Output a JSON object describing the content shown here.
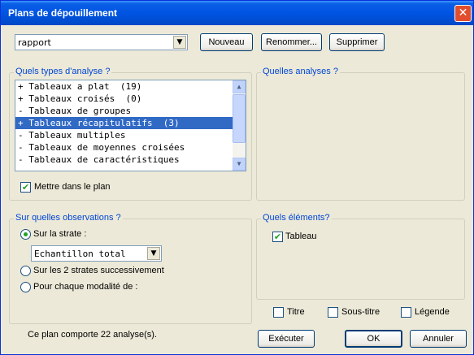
{
  "window": {
    "title": "Plans de dépouillement",
    "close_glyph": "✕"
  },
  "top": {
    "plan_combo_value": "rapport",
    "buttons": {
      "new": "Nouveau",
      "rename": "Renommer...",
      "delete": "Supprimer"
    }
  },
  "analysis_types": {
    "legend": "Quels types d'analyse ?",
    "items": [
      "+ Tableaux a plat  (19)",
      "+ Tableaux croisés  (0)",
      "- Tableaux de groupes",
      "+ Tableaux récapitulatifs  (3)",
      "- Tableaux multiples",
      "- Tableaux de moyennes croisées",
      "- Tableaux de caractéristiques"
    ],
    "selected_index": 3,
    "checkbox_label": "Mettre dans le plan",
    "checkbox_checked": true
  },
  "which_analyses": {
    "legend": "Quelles analyses ?"
  },
  "observations": {
    "legend": "Sur quelles observations ?",
    "radio_strate": "Sur la strate :",
    "strate_value": "Echantillon total",
    "radio_two_strates": "Sur les 2 strates successivement",
    "radio_modalite": "Pour chaque modalité de :",
    "selected": "strate"
  },
  "elements": {
    "legend": "Quels éléments?",
    "tableau_label": "Tableau",
    "tableau_checked": true
  },
  "bottom": {
    "status": "Ce plan comporte 22 analyse(s).",
    "titre": "Titre",
    "sous_titre": "Sous-titre",
    "legende": "Légende",
    "execute": "Exécuter",
    "ok": "OK",
    "cancel": "Annuler"
  },
  "icons": {
    "dropdown": "chevron-down-icon",
    "scroll_up": "arrow-up-icon",
    "scroll_down": "arrow-down-icon"
  },
  "colors": {
    "titlebar": "#0054e3",
    "legend_text": "#0046d5",
    "selection": "#316ac5",
    "dialog_bg": "#ece9d8"
  }
}
